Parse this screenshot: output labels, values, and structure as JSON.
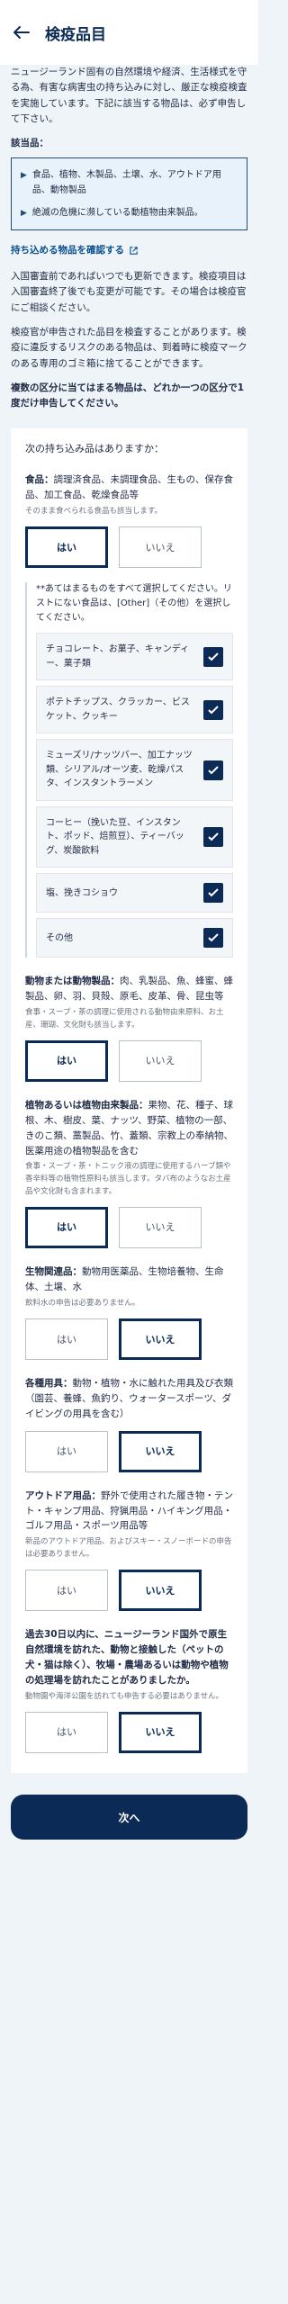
{
  "header": {
    "title": "検疫品目"
  },
  "intro": {
    "para1": "ニュージーランド固有の自然環境や経済、生活様式を守る為、有害な病害虫の持ち込みに対し、厳正な検疫検査を実施しています。下記に該当する物品は、必ず申告して下さい。",
    "label": "該当品：",
    "items": [
      "食品、植物、木製品、土壌、水、アウトドア用品、動物製品",
      "絶滅の危機に瀕している動植物由来製品。"
    ],
    "link": "持ち込める物品を確認する",
    "para2": "入国審査前であればいつでも更新できます。検疫項目は入国審査終了後でも変更が可能です。その場合は検疫官にご相談ください。",
    "para3": "検疫官が申告された品目を検査することがあります。検疫に違反するリスクのある物品は、到着時に検疫マークのある専用のゴミ箱に捨てることができます。",
    "para4": "複数の区分に当てはまる物品は、どれか一つの区分で1度だけ申告してください。"
  },
  "form": {
    "question": "次の持ち込み品はありますか：",
    "yes": "はい",
    "no": "いいえ",
    "food": {
      "title": "食品：",
      "text": "調理済食品、未調理食品、生もの、保存食品、加工食品、乾燥食品等",
      "note": "そのまま食べられる食品も該当します。"
    },
    "food_detail": {
      "intro": "**あてはまるものをすべて選択してください。リストにない食品は、[Other]（その他）を選択してください。",
      "items": [
        "チョコレート、お菓子、キャンディー、菓子類",
        "ポテトチップス、クラッカー、ビスケット、クッキー",
        "ミューズリ/ナッツバー、加工ナッツ類、シリアル/オーツ麦、乾燥パスタ、インスタントラーメン",
        "コーヒー（挽いた豆、インスタント、ポッド、焙煎豆）、ティーバッグ、炭酸飲料",
        "塩、挽きコショウ",
        "その他"
      ]
    },
    "animal": {
      "title": "動物または動物製品：",
      "text": "肉、乳製品、魚、蜂蜜、蜂製品、卵、羽、貝殻、原毛、皮革、骨、昆虫等",
      "note": "食事・スープ・茶の調理に使用される動物由来原料、お土産、珊瑚、文化財も該当します。"
    },
    "plant": {
      "title": "植物あるいは植物由来製品：",
      "text": "果物、花、種子、球根、木、樹皮、葉、ナッツ、野菜、植物の一部、きのこ類、藁製品、竹、蓋類、宗教上の奉納物、医薬用途の植物製品を含む",
      "note": "食事・スープ・茶・トニック液の調理に使用するハーブ類や香辛料等の植物性原料も該当します。タバ布のようなお土産品や文化財も含まれます。"
    },
    "bio": {
      "title": "生物関連品：",
      "text": "動物用医薬品、生物培養物、生命体、土壌、水",
      "note": "飲料水の申告は必要ありません。"
    },
    "equip": {
      "title": "各種用具：",
      "text": "動物・植物・水に触れた用具及び衣類（園芸、養蜂、魚釣り、ウォータースポーツ、ダイビングの用具を含む）"
    },
    "outdoor": {
      "title": "アウトドア用品：",
      "text": "野外で使用された履き物・テント・キャンプ用品、狩猟用品・ハイキング用品・ゴルフ用品・スポーツ用品等",
      "note": "新品のアウトドア用品、およびスキー・スノーボードの申告は必要ありません。"
    },
    "farm": {
      "text": "過去30日以内に、ニュージーランド国外で原生自然環境を訪れた、動物と接触した（ペットの犬・猫は除く）、牧場・農場あるいは動物や植物の処理場を訪れたことがありましたか。",
      "note": "動物園や海洋公園を訪れても申告する必要はありません。"
    },
    "next": "次へ"
  }
}
